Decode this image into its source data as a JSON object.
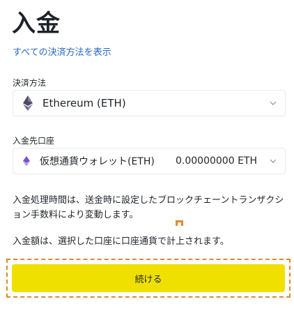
{
  "page": {
    "title": "入金",
    "show_all_methods_link": "すべての決済方法を表示"
  },
  "payment_method": {
    "label": "決済方法",
    "selected": "Ethereum (ETH)",
    "icon": "ethereum-icon"
  },
  "deposit_account": {
    "label": "入金先口座",
    "selected": "仮想通貨ウォレット(ETH)",
    "balance": "0.00000000 ETH",
    "icon": "ethereum-icon"
  },
  "notes": {
    "processing_time": "入金処理時間は、送金時に設定したブロックチェーントランザクション手数料により変動します。",
    "account_currency": "入金額は、選択した口座に口座通貨で計上されます。"
  },
  "actions": {
    "continue_label": "続ける"
  },
  "colors": {
    "link": "#2a6bc4",
    "button": "#f0e000",
    "highlight": "#e08a2c",
    "eth_icon": "#5f5f7a",
    "eth_icon_small": "#8b5fd6"
  }
}
